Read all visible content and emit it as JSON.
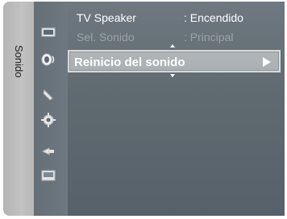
{
  "side_tab": {
    "label": "Sonido"
  },
  "icons": [
    "picture-icon",
    "sound-icon",
    "channel-icon",
    "setup-icon",
    "input-icon",
    "application-icon"
  ],
  "menu": [
    {
      "label": "TV Speaker",
      "value": ": Encendido",
      "state": "normal"
    },
    {
      "label": "Sel. Sonido",
      "value": ": Principal",
      "state": "disabled"
    },
    {
      "label": "Reinicio del sonido",
      "value": "",
      "state": "selected"
    }
  ],
  "colors": {
    "panel": "#5f6a70",
    "highlight": "#aab0b3",
    "disabled_text": "#9ba2a7",
    "text": "#ffffff"
  }
}
